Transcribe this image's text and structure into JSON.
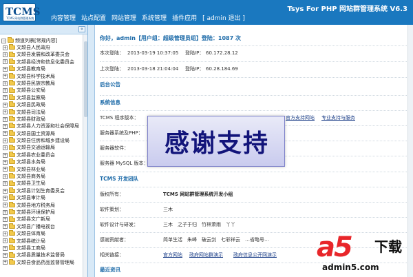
{
  "header": {
    "logo_text": "TCMS",
    "logo_sub": "TCMS 网站群管理系统",
    "nav": [
      "内容管理",
      "站点配置",
      "网站管理",
      "系统管理",
      "插件应用",
      "[ admin 退出 ]"
    ],
    "system_title": "Tsys For PHP 网站群管理系统 V6.3"
  },
  "sidebar": {
    "collapse_label": "«",
    "root_label": "频道列表[常规内容]",
    "items": [
      "文颉县人民政府",
      "文颉县发展和改革委员会",
      "文颉县经济和信息化委员会",
      "文颉县教育局",
      "文颉县科学技术局",
      "文颉县民族宗教局",
      "文颉县公安局",
      "文颉县监察局",
      "文颉县民政局",
      "文颉县司法局",
      "文颉县财政局",
      "文颉县人力资源和社会保障局",
      "文颉县国土资源局",
      "文颉县住房和城乡建设局",
      "文颉县交通运输局",
      "文颉县农业委员会",
      "文颉县水务局",
      "文颉县林业局",
      "文颉县商务局",
      "文颉县卫生局",
      "文颉县计划生育委员会",
      "文颉县审计局",
      "文颉县地方税务局",
      "文颉县环境保护局",
      "文颉县文广新局",
      "文颉县广播电视台",
      "文颉县体育局",
      "文颉县统计局",
      "文颉县工商局",
      "文颉县质量技术监督局",
      "文颉县食品药品监督管理局"
    ]
  },
  "main": {
    "welcome": "你好，admin【用户组：超级管理员组】登陆：1087 次",
    "login": {
      "this_label": "本次登陆：",
      "this_time": "2013-03-19 10:37:05",
      "this_ip_label": "登陆IP：",
      "this_ip": "60.172.28.12",
      "last_label": "上次登陆：",
      "last_time": "2013-03-18 21:04:04",
      "last_ip_label": "登陆IP：",
      "last_ip": "60.28.184.69"
    },
    "notice_title": "后台公告",
    "sysinfo_title": "系统信息",
    "sysinfo": {
      "program_label": "TCMS 程序版本：",
      "official_site": "官方支持网站",
      "support": "专业支持与服务",
      "os_label": "服务器系统及PHP：",
      "software_label": "服务器软件：",
      "mysql_label": "服务器 MySQL 版本："
    },
    "team_title": "TCMS 开发团队",
    "team": {
      "copyright_label": "版权所有：",
      "copyright_value": "TCMS 网站群管理系统开发小组",
      "planning_label": "软件策划：",
      "planning_value": "三木",
      "design_label": "软件设计与研发：",
      "design_value": "三木　之子于归　竹林萧雨　丫丫",
      "thanks_label": "感谢贡献者：",
      "thanks_value": "简单生活　朱峰　破云剑　七彩祥云　…省略号…",
      "links_label": "相关链接：",
      "link_1": "官方网站",
      "link_2": "政府网站群演示",
      "link_3": "政府信息公开网演示"
    },
    "news_title": "最近资讯"
  },
  "banner": {
    "text": "感谢支持"
  },
  "watermark": {
    "big": "a5",
    "label": "下载",
    "url": "admin5.com"
  },
  "colors": {
    "header_bg": "#1a78bf",
    "section": "#1c6aa8",
    "banner_text": "#12147a",
    "watermark_red": "#e8262a"
  }
}
